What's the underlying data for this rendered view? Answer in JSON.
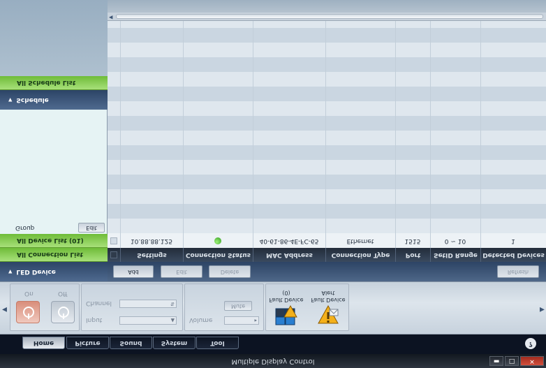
{
  "window": {
    "title": "Multiple Display Control",
    "min_label": "▬",
    "max_label": "□",
    "close_label": "✕"
  },
  "tabs": [
    {
      "label": "Home",
      "active": true
    },
    {
      "label": "Picture",
      "active": false
    },
    {
      "label": "Sound",
      "active": false
    },
    {
      "label": "System",
      "active": false
    },
    {
      "label": "Tool",
      "active": false
    }
  ],
  "help_label": "?",
  "ribbon": {
    "on_label": "On",
    "off_label": "Off",
    "channel_label": "Channel",
    "input_label": "Input",
    "mute_label": "Mute",
    "volume_label": "Volume",
    "fault_device_count": "Fault Device (0)",
    "fault_device_alert": "Fault Device Alert"
  },
  "sidebar": {
    "led_device": "LED Device",
    "all_connection_list": "All Connection List",
    "all_device_list": "All Device List (01)",
    "group_label": "Group",
    "edit_label": "Edit",
    "schedule": "Schedule",
    "all_schedule_list": "All Schedule List"
  },
  "toolbar": {
    "add_label": "Add",
    "edit_label": "Edit",
    "delete_label": "Delete",
    "refresh_label": "Refresh"
  },
  "table": {
    "columns": [
      "Settings",
      "Connection Status",
      "MAC Address",
      "Connection Type",
      "Port",
      "SetID Range",
      "Detected Devices"
    ],
    "rows": [
      {
        "settings": "10.88.88.125",
        "connection_status": "connected",
        "mac_address": "40-61-86-4E-FC-65",
        "connection_type": "Ethernet",
        "port": "1515",
        "setid_range": "0 ~ 10",
        "detected_devices": "1"
      }
    ]
  },
  "colors": {
    "accent_green": "#7cc444",
    "header_blue": "#3e5678",
    "status_ok": "#2e9a1c"
  }
}
